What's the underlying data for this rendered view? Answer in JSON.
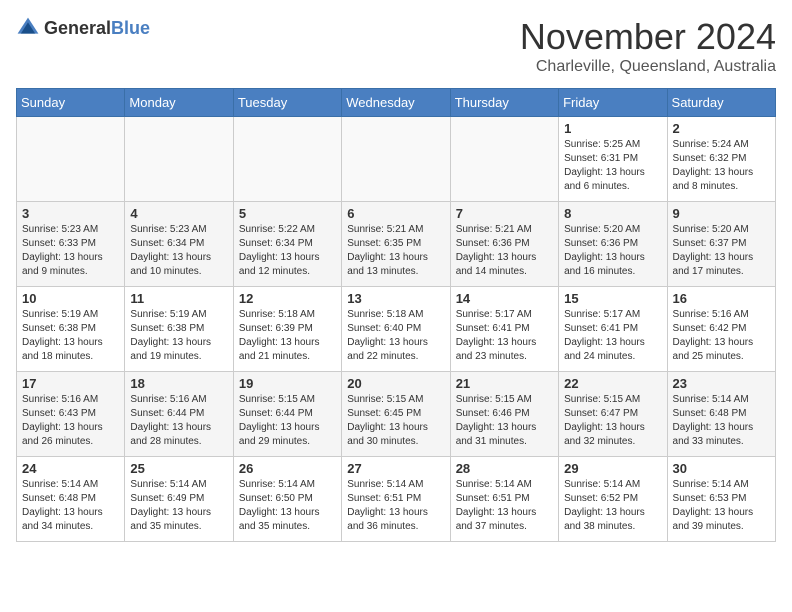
{
  "header": {
    "logo_general": "General",
    "logo_blue": "Blue",
    "month": "November 2024",
    "location": "Charleville, Queensland, Australia"
  },
  "weekdays": [
    "Sunday",
    "Monday",
    "Tuesday",
    "Wednesday",
    "Thursday",
    "Friday",
    "Saturday"
  ],
  "weeks": [
    [
      {
        "day": "",
        "info": ""
      },
      {
        "day": "",
        "info": ""
      },
      {
        "day": "",
        "info": ""
      },
      {
        "day": "",
        "info": ""
      },
      {
        "day": "",
        "info": ""
      },
      {
        "day": "1",
        "info": "Sunrise: 5:25 AM\nSunset: 6:31 PM\nDaylight: 13 hours and 6 minutes."
      },
      {
        "day": "2",
        "info": "Sunrise: 5:24 AM\nSunset: 6:32 PM\nDaylight: 13 hours and 8 minutes."
      }
    ],
    [
      {
        "day": "3",
        "info": "Sunrise: 5:23 AM\nSunset: 6:33 PM\nDaylight: 13 hours and 9 minutes."
      },
      {
        "day": "4",
        "info": "Sunrise: 5:23 AM\nSunset: 6:34 PM\nDaylight: 13 hours and 10 minutes."
      },
      {
        "day": "5",
        "info": "Sunrise: 5:22 AM\nSunset: 6:34 PM\nDaylight: 13 hours and 12 minutes."
      },
      {
        "day": "6",
        "info": "Sunrise: 5:21 AM\nSunset: 6:35 PM\nDaylight: 13 hours and 13 minutes."
      },
      {
        "day": "7",
        "info": "Sunrise: 5:21 AM\nSunset: 6:36 PM\nDaylight: 13 hours and 14 minutes."
      },
      {
        "day": "8",
        "info": "Sunrise: 5:20 AM\nSunset: 6:36 PM\nDaylight: 13 hours and 16 minutes."
      },
      {
        "day": "9",
        "info": "Sunrise: 5:20 AM\nSunset: 6:37 PM\nDaylight: 13 hours and 17 minutes."
      }
    ],
    [
      {
        "day": "10",
        "info": "Sunrise: 5:19 AM\nSunset: 6:38 PM\nDaylight: 13 hours and 18 minutes."
      },
      {
        "day": "11",
        "info": "Sunrise: 5:19 AM\nSunset: 6:38 PM\nDaylight: 13 hours and 19 minutes."
      },
      {
        "day": "12",
        "info": "Sunrise: 5:18 AM\nSunset: 6:39 PM\nDaylight: 13 hours and 21 minutes."
      },
      {
        "day": "13",
        "info": "Sunrise: 5:18 AM\nSunset: 6:40 PM\nDaylight: 13 hours and 22 minutes."
      },
      {
        "day": "14",
        "info": "Sunrise: 5:17 AM\nSunset: 6:41 PM\nDaylight: 13 hours and 23 minutes."
      },
      {
        "day": "15",
        "info": "Sunrise: 5:17 AM\nSunset: 6:41 PM\nDaylight: 13 hours and 24 minutes."
      },
      {
        "day": "16",
        "info": "Sunrise: 5:16 AM\nSunset: 6:42 PM\nDaylight: 13 hours and 25 minutes."
      }
    ],
    [
      {
        "day": "17",
        "info": "Sunrise: 5:16 AM\nSunset: 6:43 PM\nDaylight: 13 hours and 26 minutes."
      },
      {
        "day": "18",
        "info": "Sunrise: 5:16 AM\nSunset: 6:44 PM\nDaylight: 13 hours and 28 minutes."
      },
      {
        "day": "19",
        "info": "Sunrise: 5:15 AM\nSunset: 6:44 PM\nDaylight: 13 hours and 29 minutes."
      },
      {
        "day": "20",
        "info": "Sunrise: 5:15 AM\nSunset: 6:45 PM\nDaylight: 13 hours and 30 minutes."
      },
      {
        "day": "21",
        "info": "Sunrise: 5:15 AM\nSunset: 6:46 PM\nDaylight: 13 hours and 31 minutes."
      },
      {
        "day": "22",
        "info": "Sunrise: 5:15 AM\nSunset: 6:47 PM\nDaylight: 13 hours and 32 minutes."
      },
      {
        "day": "23",
        "info": "Sunrise: 5:14 AM\nSunset: 6:48 PM\nDaylight: 13 hours and 33 minutes."
      }
    ],
    [
      {
        "day": "24",
        "info": "Sunrise: 5:14 AM\nSunset: 6:48 PM\nDaylight: 13 hours and 34 minutes."
      },
      {
        "day": "25",
        "info": "Sunrise: 5:14 AM\nSunset: 6:49 PM\nDaylight: 13 hours and 35 minutes."
      },
      {
        "day": "26",
        "info": "Sunrise: 5:14 AM\nSunset: 6:50 PM\nDaylight: 13 hours and 35 minutes."
      },
      {
        "day": "27",
        "info": "Sunrise: 5:14 AM\nSunset: 6:51 PM\nDaylight: 13 hours and 36 minutes."
      },
      {
        "day": "28",
        "info": "Sunrise: 5:14 AM\nSunset: 6:51 PM\nDaylight: 13 hours and 37 minutes."
      },
      {
        "day": "29",
        "info": "Sunrise: 5:14 AM\nSunset: 6:52 PM\nDaylight: 13 hours and 38 minutes."
      },
      {
        "day": "30",
        "info": "Sunrise: 5:14 AM\nSunset: 6:53 PM\nDaylight: 13 hours and 39 minutes."
      }
    ]
  ]
}
